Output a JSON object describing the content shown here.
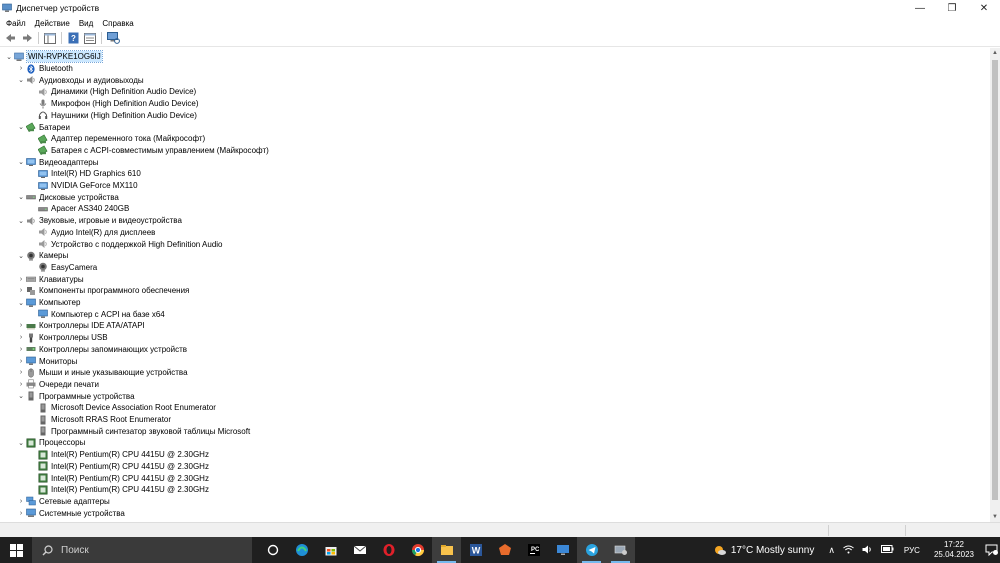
{
  "window": {
    "title": "Диспетчер устройств",
    "minimize": "—",
    "maximize": "❐",
    "close": "✕"
  },
  "menu": [
    "Файл",
    "Действие",
    "Вид",
    "Справка"
  ],
  "tree": [
    {
      "label": "WIN-RVPKE1OG6IJ",
      "level": 0,
      "arrow": "v",
      "icon": "computer-icon",
      "selected": true
    },
    {
      "label": "Bluetooth",
      "level": 1,
      "arrow": ">",
      "icon": "bluetooth-icon"
    },
    {
      "label": "Аудиовходы и аудиовыходы",
      "level": 1,
      "arrow": "v",
      "icon": "audio-icon"
    },
    {
      "label": "Динамики (High Definition Audio Device)",
      "level": 2,
      "icon": "speaker-icon"
    },
    {
      "label": "Микрофон (High Definition Audio Device)",
      "level": 2,
      "icon": "microphone-icon"
    },
    {
      "label": "Наушники (High Definition Audio Device)",
      "level": 2,
      "icon": "headphones-icon"
    },
    {
      "label": "Батареи",
      "level": 1,
      "arrow": "v",
      "icon": "battery-icon"
    },
    {
      "label": "Адаптер переменного тока (Майкрософт)",
      "level": 2,
      "icon": "battery-icon"
    },
    {
      "label": "Батарея с ACPI-совместимым управлением (Майкрософт)",
      "level": 2,
      "icon": "battery-icon"
    },
    {
      "label": "Видеоадаптеры",
      "level": 1,
      "arrow": "v",
      "icon": "display-adapter-icon"
    },
    {
      "label": "Intel(R) HD Graphics 610",
      "level": 2,
      "icon": "display-adapter-icon"
    },
    {
      "label": "NVIDIA GeForce MX110",
      "level": 2,
      "icon": "display-adapter-icon"
    },
    {
      "label": "Дисковые устройства",
      "level": 1,
      "arrow": "v",
      "icon": "disk-icon"
    },
    {
      "label": "Apacer AS340 240GB",
      "level": 2,
      "icon": "disk-icon"
    },
    {
      "label": "Звуковые, игровые и видеоустройства",
      "level": 1,
      "arrow": "v",
      "icon": "audio-icon"
    },
    {
      "label": "Аудио Intel(R) для дисплеев",
      "level": 2,
      "icon": "speaker-icon"
    },
    {
      "label": "Устройство с поддержкой High Definition Audio",
      "level": 2,
      "icon": "speaker-icon"
    },
    {
      "label": "Камеры",
      "level": 1,
      "arrow": "v",
      "icon": "camera-icon"
    },
    {
      "label": "EasyCamera",
      "level": 2,
      "icon": "camera-icon"
    },
    {
      "label": "Клавиатуры",
      "level": 1,
      "arrow": ">",
      "icon": "keyboard-icon"
    },
    {
      "label": "Компоненты программного обеспечения",
      "level": 1,
      "arrow": ">",
      "icon": "software-component-icon"
    },
    {
      "label": "Компьютер",
      "level": 1,
      "arrow": "v",
      "icon": "monitor-icon"
    },
    {
      "label": "Компьютер с ACPI на базе x64",
      "level": 2,
      "icon": "monitor-icon"
    },
    {
      "label": "Контроллеры IDE ATA/ATAPI",
      "level": 1,
      "arrow": ">",
      "icon": "ide-controller-icon"
    },
    {
      "label": "Контроллеры USB",
      "level": 1,
      "arrow": ">",
      "icon": "usb-icon"
    },
    {
      "label": "Контроллеры запоминающих устройств",
      "level": 1,
      "arrow": ">",
      "icon": "storage-controller-icon"
    },
    {
      "label": "Мониторы",
      "level": 1,
      "arrow": ">",
      "icon": "monitor-icon"
    },
    {
      "label": "Мыши и иные указывающие устройства",
      "level": 1,
      "arrow": ">",
      "icon": "mouse-icon"
    },
    {
      "label": "Очереди печати",
      "level": 1,
      "arrow": ">",
      "icon": "printer-icon"
    },
    {
      "label": "Программные устройства",
      "level": 1,
      "arrow": "v",
      "icon": "software-device-icon"
    },
    {
      "label": "Microsoft Device Association Root Enumerator",
      "level": 2,
      "icon": "software-device-icon"
    },
    {
      "label": "Microsoft RRAS Root Enumerator",
      "level": 2,
      "icon": "software-device-icon"
    },
    {
      "label": "Программный синтезатор звуковой таблицы Microsoft",
      "level": 2,
      "icon": "software-device-icon"
    },
    {
      "label": "Процессоры",
      "level": 1,
      "arrow": "v",
      "icon": "processor-icon"
    },
    {
      "label": "Intel(R) Pentium(R) CPU 4415U @ 2.30GHz",
      "level": 2,
      "icon": "processor-icon"
    },
    {
      "label": "Intel(R) Pentium(R) CPU 4415U @ 2.30GHz",
      "level": 2,
      "icon": "processor-icon"
    },
    {
      "label": "Intel(R) Pentium(R) CPU 4415U @ 2.30GHz",
      "level": 2,
      "icon": "processor-icon"
    },
    {
      "label": "Intel(R) Pentium(R) CPU 4415U @ 2.30GHz",
      "level": 2,
      "icon": "processor-icon"
    },
    {
      "label": "Сетевые адаптеры",
      "level": 1,
      "arrow": ">",
      "icon": "network-adapter-icon"
    },
    {
      "label": "Системные устройства",
      "level": 1,
      "arrow": ">",
      "icon": "system-device-icon"
    }
  ],
  "taskbar": {
    "search_placeholder": "Поиск",
    "apps": [
      "task-view-icon",
      "edge-icon",
      "store-icon",
      "mail-icon",
      "opera-icon",
      "chrome-icon",
      "file-explorer-icon",
      "word-icon",
      "app-orange-icon",
      "pycharm-icon",
      "remote-desktop-icon",
      "telegram-icon",
      "device-manager-icon"
    ],
    "active_apps": [
      "file-explorer-icon",
      "telegram-icon",
      "device-manager-icon"
    ],
    "weather": "17°C  Mostly sunny",
    "lang": "РУС",
    "time": "17:22",
    "date": "25.04.2023"
  },
  "colors": {
    "selection": "#cce8ff",
    "taskbar": "#1f1f1f",
    "accent": "#76b9ed"
  }
}
